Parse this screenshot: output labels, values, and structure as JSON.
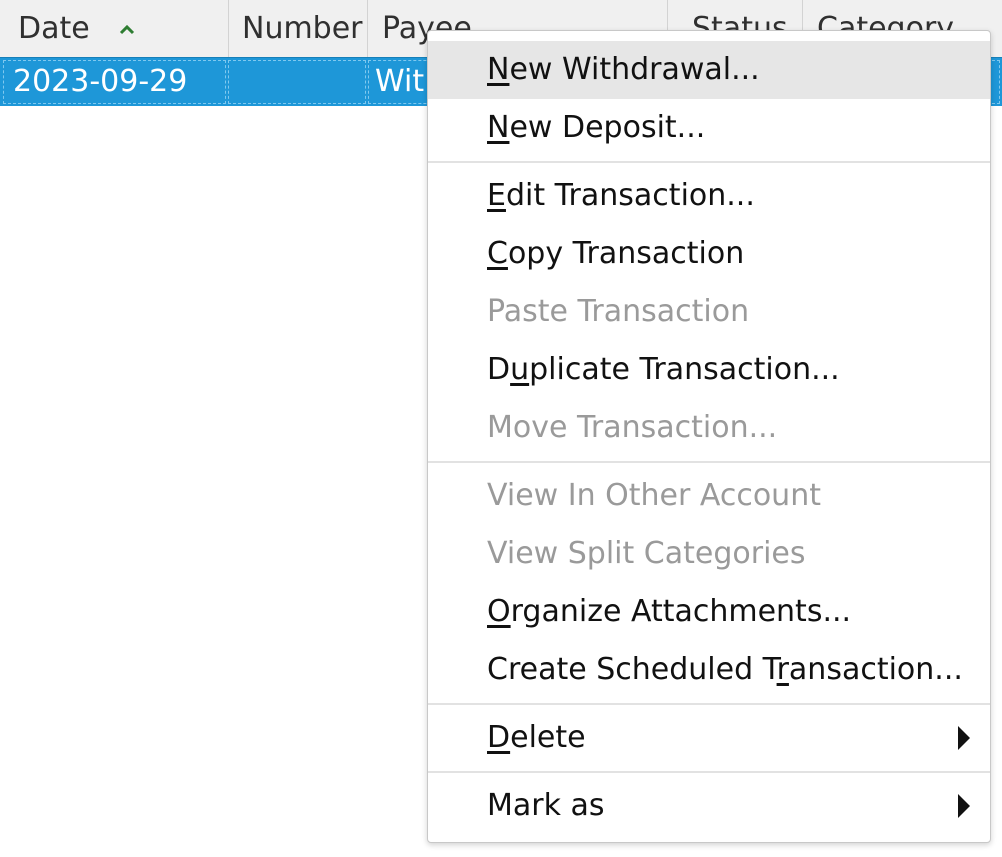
{
  "table": {
    "columns": {
      "date": "Date",
      "number": "Number",
      "payee": "Payee",
      "status": "Status",
      "category": "Category"
    },
    "sort_icon": "chevron-up-icon",
    "selected_row": {
      "date": "2023-09-29",
      "number": "",
      "payee": "Wit"
    }
  },
  "menu": {
    "new_withdrawal": {
      "pre": "",
      "key": "N",
      "post": "ew Withdrawal..."
    },
    "new_deposit": {
      "pre": "",
      "key": "N",
      "post": "ew Deposit..."
    },
    "edit_transaction": {
      "pre": "",
      "key": "E",
      "post": "dit Transaction..."
    },
    "copy_transaction": {
      "pre": "",
      "key": "C",
      "post": "opy Transaction"
    },
    "paste_transaction": "Paste Transaction",
    "duplicate_transaction": {
      "pre": "D",
      "key": "u",
      "post": "plicate Transaction..."
    },
    "move_transaction": "Move Transaction...",
    "view_in_other_account": "View In Other Account",
    "view_split_categories": "View Split Categories",
    "organize_attachments": {
      "pre": "",
      "key": "O",
      "post": "rganize Attachments..."
    },
    "create_scheduled_transaction": {
      "pre": "Create Scheduled T",
      "key": "r",
      "post": "ansaction..."
    },
    "delete": {
      "pre": "",
      "key": "D",
      "post": "elete"
    },
    "mark_as": "Mark as"
  },
  "colors": {
    "selection": "#1e97d8",
    "highlight": "#e6e6e6",
    "disabled_text": "#9a9a9a",
    "sort_arrow": "#2e7d32"
  }
}
